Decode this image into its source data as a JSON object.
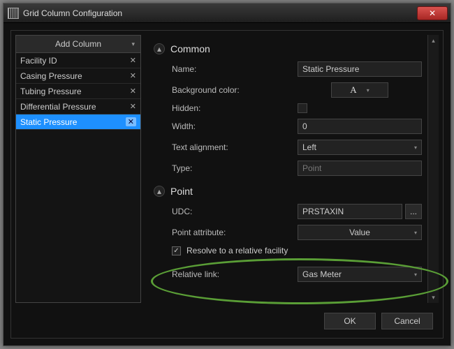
{
  "window": {
    "title": "Grid Column Configuration"
  },
  "sidebar": {
    "add_label": "Add Column",
    "items": [
      {
        "label": "Facility ID",
        "selected": false
      },
      {
        "label": "Casing Pressure",
        "selected": false
      },
      {
        "label": "Tubing Pressure",
        "selected": false
      },
      {
        "label": "Differential Pressure",
        "selected": false
      },
      {
        "label": "Static Pressure",
        "selected": true
      }
    ]
  },
  "common": {
    "heading": "Common",
    "name_label": "Name:",
    "name_value": "Static Pressure",
    "bg_label": "Background color:",
    "hidden_label": "Hidden:",
    "width_label": "Width:",
    "width_value": "0",
    "align_label": "Text alignment:",
    "align_value": "Left",
    "type_label": "Type:",
    "type_value": "Point"
  },
  "point": {
    "heading": "Point",
    "udc_label": "UDC:",
    "udc_value": "PRSTAXIN",
    "browse": "...",
    "attr_label": "Point attribute:",
    "attr_value": "Value",
    "resolve_label": "Resolve to a relative facility",
    "resolve_checked": true,
    "link_label": "Relative link:",
    "link_value": "Gas Meter"
  },
  "buttons": {
    "ok": "OK",
    "cancel": "Cancel"
  }
}
